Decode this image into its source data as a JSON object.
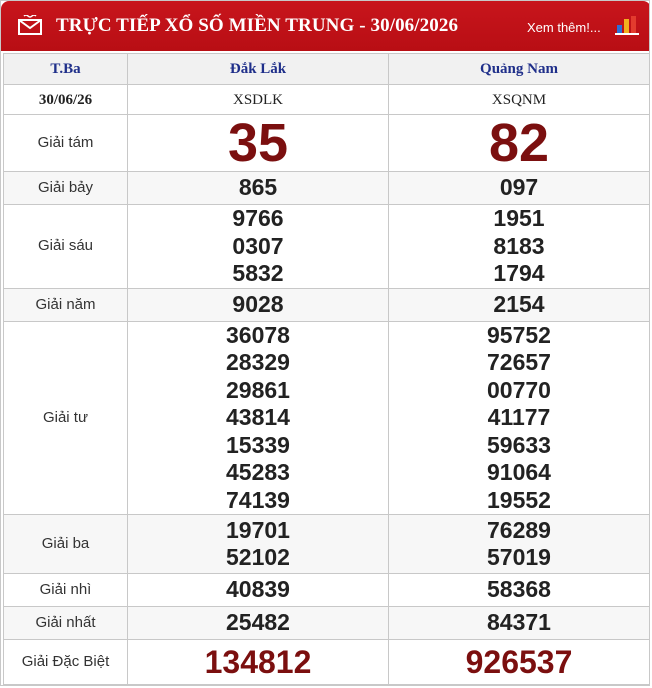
{
  "header": {
    "title": "TRỰC TIẾP XỔ SỐ MIỀN TRUNG - 30/06/2026",
    "more_link": "Xem thêm!...",
    "mail_icon": "envelope-icon",
    "chart_icon": "bar-chart-icon",
    "accent_color": "#c8151c"
  },
  "table": {
    "day_label": "T.Ba",
    "date": "30/06/26",
    "provinces": [
      {
        "name": "Đắk Lắk",
        "code": "XSDLK"
      },
      {
        "name": "Quảng Nam",
        "code": "XSQNM"
      }
    ],
    "prizes": {
      "g8": {
        "label": "Giải tám",
        "values": [
          "35",
          "82"
        ]
      },
      "g7": {
        "label": "Giải bảy",
        "values": [
          "865",
          "097"
        ]
      },
      "g6": {
        "label": "Giải sáu",
        "values": [
          [
            "9766",
            "0307",
            "5832"
          ],
          [
            "1951",
            "8183",
            "1794"
          ]
        ]
      },
      "g5": {
        "label": "Giải năm",
        "values": [
          "9028",
          "2154"
        ]
      },
      "g4": {
        "label": "Giải tư",
        "values": [
          [
            "36078",
            "28329",
            "29861",
            "43814",
            "15339",
            "45283",
            "74139"
          ],
          [
            "95752",
            "72657",
            "00770",
            "41177",
            "59633",
            "91064",
            "19552"
          ]
        ]
      },
      "g3": {
        "label": "Giải ba",
        "values": [
          [
            "19701",
            "52102"
          ],
          [
            "76289",
            "57019"
          ]
        ]
      },
      "g2": {
        "label": "Giải nhì",
        "values": [
          "40839",
          "58368"
        ]
      },
      "g1": {
        "label": "Giải nhất",
        "values": [
          "25482",
          "84371"
        ]
      },
      "gdb": {
        "label": "Giải Đặc Biệt",
        "values": [
          "134812",
          "926537"
        ]
      }
    }
  }
}
